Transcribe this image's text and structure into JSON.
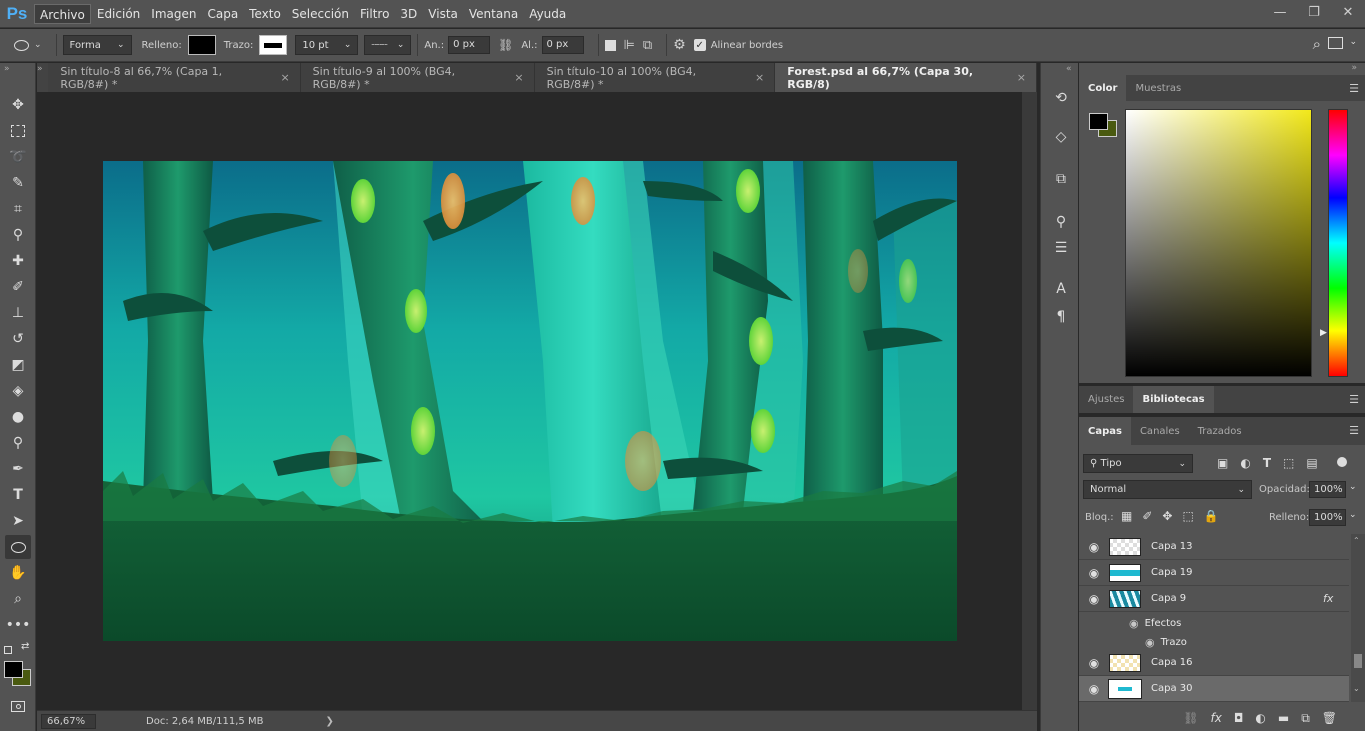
{
  "app": {
    "logo": "Ps"
  },
  "menu": [
    "Archivo",
    "Edición",
    "Imagen",
    "Capa",
    "Texto",
    "Selección",
    "Filtro",
    "3D",
    "Vista",
    "Ventana",
    "Ayuda"
  ],
  "window_controls": {
    "minimize": "—",
    "restore": "❐",
    "close": "✕"
  },
  "options": {
    "mode": "Forma",
    "fill_label": "Relleno:",
    "stroke_label": "Trazo:",
    "stroke_size": "10 pt",
    "width_label": "An.:",
    "width_value": "0 px",
    "height_label": "Al.:",
    "height_value": "0 px",
    "align_edges": "Alinear bordes"
  },
  "tabs": [
    {
      "label": "Sin título-8 al 66,7% (Capa 1, RGB/8#) *",
      "active": false
    },
    {
      "label": "Sin título-9 al 100% (BG4, RGB/8#) *",
      "active": false
    },
    {
      "label": "Sin título-10 al 100% (BG4, RGB/8#) *",
      "active": false
    },
    {
      "label": "Forest.psd al 66,7% (Capa 30, RGB/8)",
      "active": true
    }
  ],
  "tab_close": "×",
  "status": {
    "zoom": "66,67%",
    "doc": "Doc: 2,64 MB/111,5 MB",
    "arrow": "❯"
  },
  "color_panel": {
    "tabs": [
      "Color",
      "Muestras"
    ],
    "fg": "#000000",
    "bg": "#4a5a10",
    "hue_color": "#f2e81a"
  },
  "adjust_panel": {
    "tabs": [
      "Ajustes",
      "Bibliotecas"
    ]
  },
  "layers_panel": {
    "tabs": [
      "Capas",
      "Canales",
      "Trazados"
    ],
    "kind": "Tipo",
    "blend": "Normal",
    "opacity_label": "Opacidad:",
    "opacity": "100%",
    "lock_label": "Bloq.:",
    "fill_label": "Relleno:",
    "fill": "100%",
    "layers": [
      {
        "name": "Capa 13"
      },
      {
        "name": "Capa 19"
      },
      {
        "name": "Capa 9",
        "fx": "fx"
      },
      {
        "name": "Capa 16"
      },
      {
        "name": "Capa 30",
        "selected": true
      }
    ],
    "effects_label": "Efectos",
    "stroke_effect": "Trazo"
  },
  "icons": {
    "tools": [
      "move-icon",
      "marquee-icon",
      "lasso-icon",
      "quick-select-icon",
      "crop-icon",
      "eyedropper-icon",
      "healing-icon",
      "brush-icon",
      "stamp-icon",
      "history-brush-icon",
      "eraser-icon",
      "bucket-icon",
      "blur-icon",
      "dodge-icon",
      "pen-icon",
      "type-icon",
      "path-select-icon",
      "ellipse-icon",
      "hand-icon",
      "zoom-icon",
      "more-icon"
    ]
  }
}
